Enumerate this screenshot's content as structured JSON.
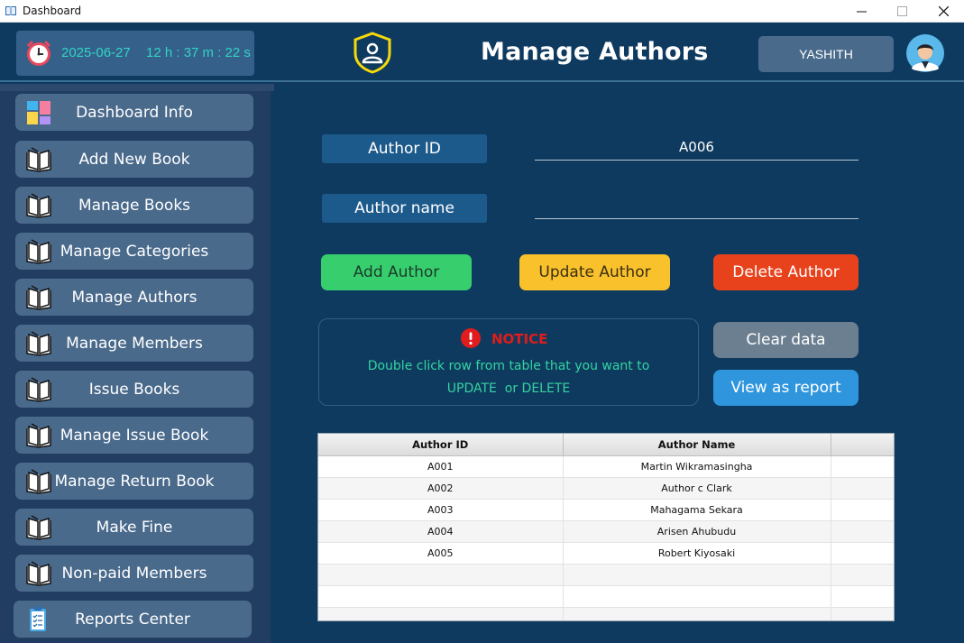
{
  "window": {
    "title": "Dashboard"
  },
  "header": {
    "date": "2025-06-27",
    "time": "12 h : 37 m : 22 s",
    "page_title": "Manage Authors",
    "user_name": "YASHITH"
  },
  "sidebar": {
    "items": [
      {
        "label": "Dashboard Info",
        "icon": "dashboard-tiles-icon"
      },
      {
        "label": "Add New Book",
        "icon": "book-icon"
      },
      {
        "label": "Manage Books",
        "icon": "book-icon"
      },
      {
        "label": "Manage Categories",
        "icon": "book-icon"
      },
      {
        "label": "Manage Authors",
        "icon": "book-icon"
      },
      {
        "label": "Manage Members",
        "icon": "book-icon"
      },
      {
        "label": "Issue Books",
        "icon": "book-icon"
      },
      {
        "label": "Manage Issue Book",
        "icon": "book-icon"
      },
      {
        "label": "Manage Return Book",
        "icon": "book-icon"
      },
      {
        "label": "Make Fine",
        "icon": "book-icon"
      },
      {
        "label": "Non-paid Members",
        "icon": "book-icon"
      },
      {
        "label": "Reports Center",
        "icon": "clipboard-checklist-icon"
      }
    ]
  },
  "form": {
    "author_id_label": "Author ID",
    "author_id_value": "A006",
    "author_name_label": "Author name",
    "author_name_value": ""
  },
  "actions": {
    "add": "Add Author",
    "update": "Update Author",
    "delete": "Delete Author",
    "clear": "Clear data",
    "report": "View as report"
  },
  "notice": {
    "title": "NOTICE",
    "line1": "Double click row from table that you want to",
    "line2": "UPDATE  or DELETE"
  },
  "table": {
    "columns": [
      "Author ID",
      "Author Name",
      ""
    ],
    "rows": [
      [
        "A001",
        "Martin Wikramasingha",
        ""
      ],
      [
        "A002",
        "Author c Clark",
        ""
      ],
      [
        "A003",
        "Mahagama Sekara",
        ""
      ],
      [
        "A004",
        "Arisen Ahubudu",
        ""
      ],
      [
        "A005",
        "Robert Kiyosaki",
        ""
      ],
      [
        "",
        "",
        ""
      ],
      [
        "",
        "",
        ""
      ],
      [
        "",
        "",
        ""
      ]
    ]
  },
  "colors": {
    "background": "#0f3a5f",
    "sidebar": "#213e62",
    "button_add": "#37cf6e",
    "button_update": "#f9c12c",
    "button_delete": "#e8421c",
    "button_clear": "#6c7f91",
    "button_report": "#2f96dd",
    "accent_text": "#33d4c5",
    "notice_red": "#e11c1c"
  }
}
